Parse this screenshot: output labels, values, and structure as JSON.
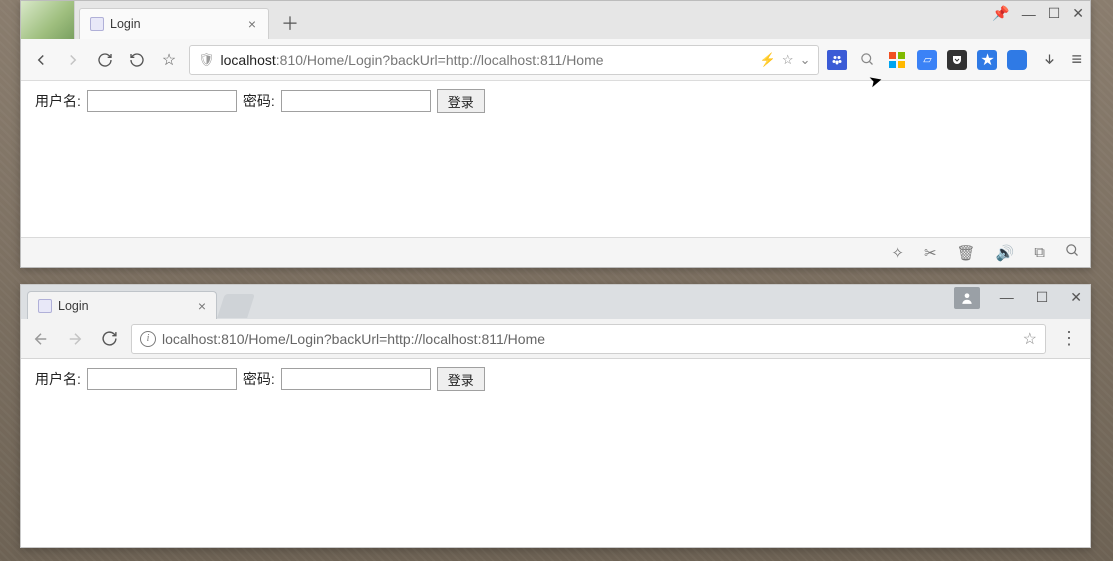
{
  "firefox": {
    "tab_title": "Login",
    "url_host": "localhost",
    "url_rest": ":810/Home/Login?backUrl=http://localhost:811/Home",
    "page": {
      "username_label": "用户名:",
      "password_label": "密码:",
      "login_button": "登录",
      "username_value": "",
      "password_value": ""
    }
  },
  "chrome": {
    "tab_title": "Login",
    "url": "localhost:810/Home/Login?backUrl=http://localhost:811/Home",
    "page": {
      "username_label": "用户名:",
      "password_label": "密码:",
      "login_button": "登录",
      "username_value": "",
      "password_value": ""
    }
  }
}
